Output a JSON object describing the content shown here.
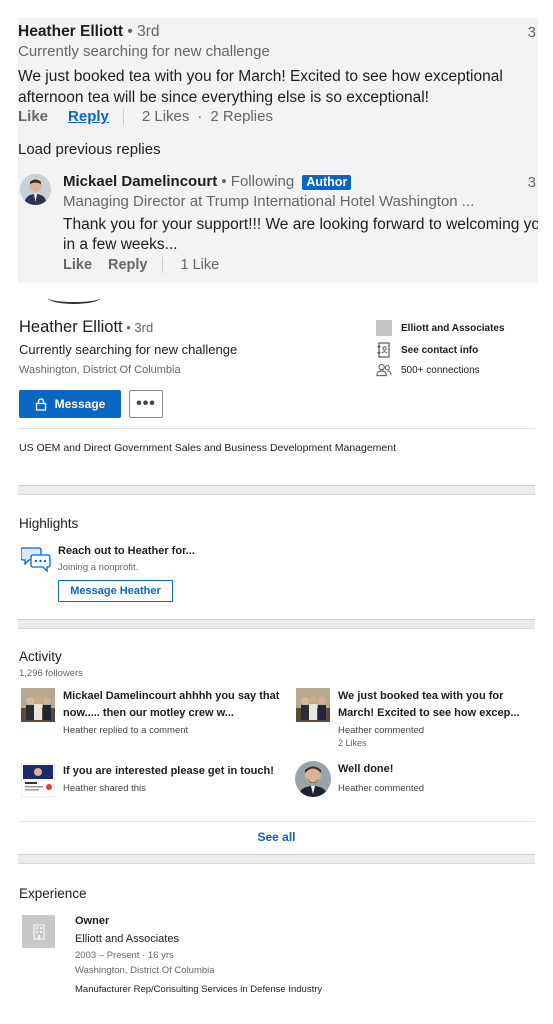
{
  "comment": {
    "author": "Heather Elliott",
    "degree": " • 3rd",
    "time": "3",
    "subtitle": "Currently searching for new challenge",
    "text": "We just booked tea with you for March! Excited to see how exceptional afternoon tea will be since everything else is so exceptional!",
    "like_label": "Like",
    "reply_label": "Reply",
    "likes": "2 Likes",
    "replies": "2 Replies",
    "load_previous": "Load previous replies"
  },
  "reply": {
    "author": "Mickael Damelincourt",
    "following": " • Following",
    "badge": "Author",
    "time": "3",
    "subtitle": "Managing Director at Trump International Hotel Washington ...",
    "text": "Thank you for your support!!! We are looking forward to welcoming you in a few weeks...",
    "like_label": "Like",
    "reply_label": "Reply",
    "likes": "1 Like"
  },
  "profile": {
    "name": "Heather Elliott",
    "degree": " • 3rd",
    "headline": "Currently searching for new challenge",
    "location": "Washington, District Of Columbia",
    "company": "Elliott and Associates",
    "contact_info": "See contact info",
    "connections": "500+ connections",
    "message_label": "Message",
    "more_label": "•••",
    "summary": "US OEM and Direct Government Sales and Business Development Management"
  },
  "highlights": {
    "title": "Highlights",
    "item_title": "Reach out to Heather for...",
    "item_sub": "Joining a nonprofit.",
    "button": "Message Heather"
  },
  "activity": {
    "title": "Activity",
    "followers": "1,296 followers",
    "items": [
      {
        "title": "Mickael Damelincourt ahhhh you say that now..... then our motley crew w...",
        "meta": "Heather replied to a comment",
        "likes": "",
        "thumb_icon": "group-photo"
      },
      {
        "title": "We just booked tea with you for March! Excited to see how excep...",
        "meta": "Heather commented",
        "likes": "2 Likes",
        "thumb_icon": "group-photo"
      },
      {
        "title": "If you are interested please get in touch!",
        "meta": "Heather shared this",
        "likes": "",
        "thumb_icon": "document-thumb"
      },
      {
        "title": "Well done!",
        "meta": "Heather commented",
        "likes": "",
        "thumb_icon": "person-photo"
      }
    ],
    "see_all": "See all"
  },
  "experience": {
    "title": "Experience",
    "role": "Owner",
    "company": "Elliott and Associates",
    "dates": "2003 – Present · 16 yrs",
    "location": "Washington, District Of Columbia",
    "description": "Manufacturer Rep/Consulting Services in Defense Industry"
  },
  "colors": {
    "brand_blue": "#0a66c2",
    "thread_bg": "#f3f3f3",
    "muted_text": "#666666"
  }
}
